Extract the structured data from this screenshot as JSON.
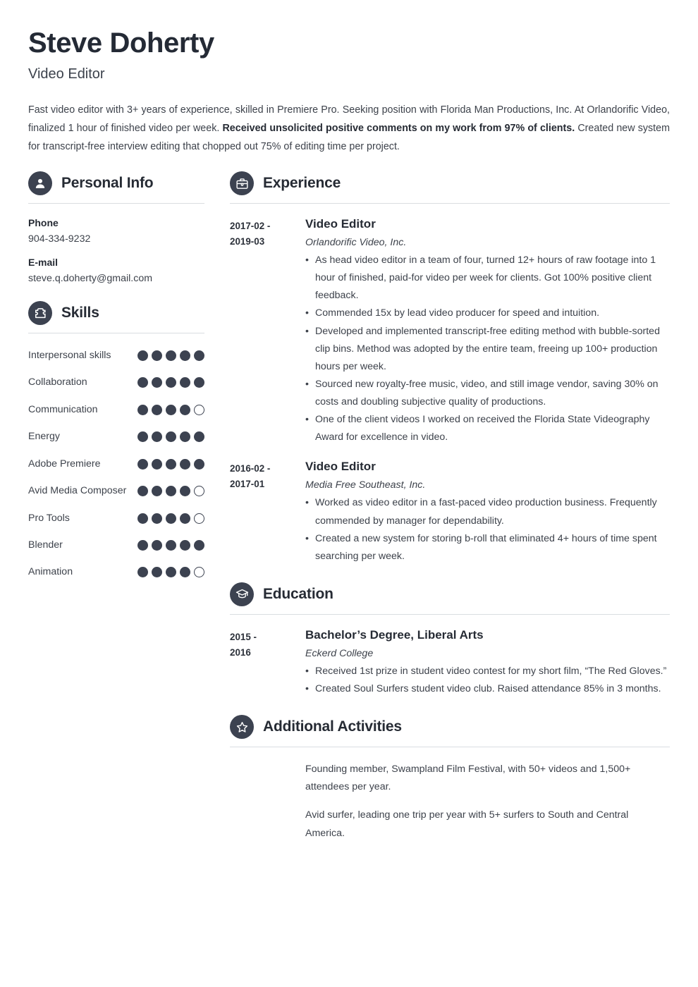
{
  "header": {
    "name": "Steve Doherty",
    "job_title": "Video Editor",
    "summary_part1": "Fast video editor with 3+ years of experience, skilled in Premiere Pro. Seeking position with Florida Man Productions, Inc. At Orlandorific Video, finalized 1 hour of finished video per week. ",
    "summary_bold": "Received unsolicited positive comments on my work from 97% of clients.",
    "summary_part2": " Created new system for transcript-free interview editing that chopped out 75% of editing time per project."
  },
  "colors": {
    "icon_circle": "#3c4250",
    "heading": "#262b34",
    "body_text": "#3d424b",
    "rule": "#dadde1"
  },
  "personal_info": {
    "section_title": "Personal Info",
    "icon": "person-icon",
    "fields": [
      {
        "label": "Phone",
        "value": "904-334-9232"
      },
      {
        "label": "E-mail",
        "value": "steve.q.doherty@gmail.com"
      }
    ]
  },
  "skills": {
    "section_title": "Skills",
    "icon": "puzzle-piece-icon",
    "max_rating": 5,
    "items": [
      {
        "name": "Interpersonal skills",
        "rating": 5
      },
      {
        "name": "Collaboration",
        "rating": 5
      },
      {
        "name": "Communication",
        "rating": 4
      },
      {
        "name": "Energy",
        "rating": 5
      },
      {
        "name": "Adobe Premiere",
        "rating": 5
      },
      {
        "name": "Avid Media Composer",
        "rating": 4
      },
      {
        "name": "Pro Tools",
        "rating": 4
      },
      {
        "name": "Blender",
        "rating": 5
      },
      {
        "name": "Animation",
        "rating": 4
      }
    ]
  },
  "experience": {
    "section_title": "Experience",
    "icon": "briefcase-icon",
    "entries": [
      {
        "date_start": "2017-02 -",
        "date_end": "2019-03",
        "role": "Video Editor",
        "organization": "Orlandorific Video, Inc.",
        "bullets": [
          "As head video editor in a team of four, turned 12+ hours of raw footage into 1 hour of finished, paid-for video per week for clients. Got 100% positive client feedback.",
          "Commended 15x by lead video producer for speed and intuition.",
          "Developed and implemented transcript-free editing method with bubble-sorted clip bins. Method was adopted by the entire team, freeing up 100+ production hours per week.",
          "Sourced new royalty-free music, video, and still image vendor, saving 30% on costs and doubling subjective quality of productions.",
          "One of the client videos I worked on received the Florida State Videography Award for excellence in video."
        ]
      },
      {
        "date_start": "2016-02 -",
        "date_end": "2017-01",
        "role": "Video Editor",
        "organization": "Media Free Southeast, Inc.",
        "bullets": [
          "Worked as video editor in a fast-paced video production business. Frequently commended by manager for dependability.",
          "Created a new system for storing b-roll that eliminated 4+ hours of time spent searching per week."
        ]
      }
    ]
  },
  "education": {
    "section_title": "Education",
    "icon": "graduation-cap-icon",
    "entries": [
      {
        "date_start": "2015 -",
        "date_end": "2016",
        "degree": "Bachelor’s Degree, Liberal Arts",
        "school": "Eckerd College",
        "bullets": [
          "Received 1st prize in student video contest for my short film, “The Red Gloves.”",
          "Created Soul Surfers student video club. Raised attendance 85% in 3 months."
        ]
      }
    ]
  },
  "additional_activities": {
    "section_title": "Additional Activities",
    "icon": "star-icon",
    "paragraphs": [
      "Founding member, Swampland Film Festival, with 50+ videos and 1,500+ attendees per year.",
      "Avid surfer, leading one trip per year with 5+ surfers to South and Central America."
    ]
  }
}
